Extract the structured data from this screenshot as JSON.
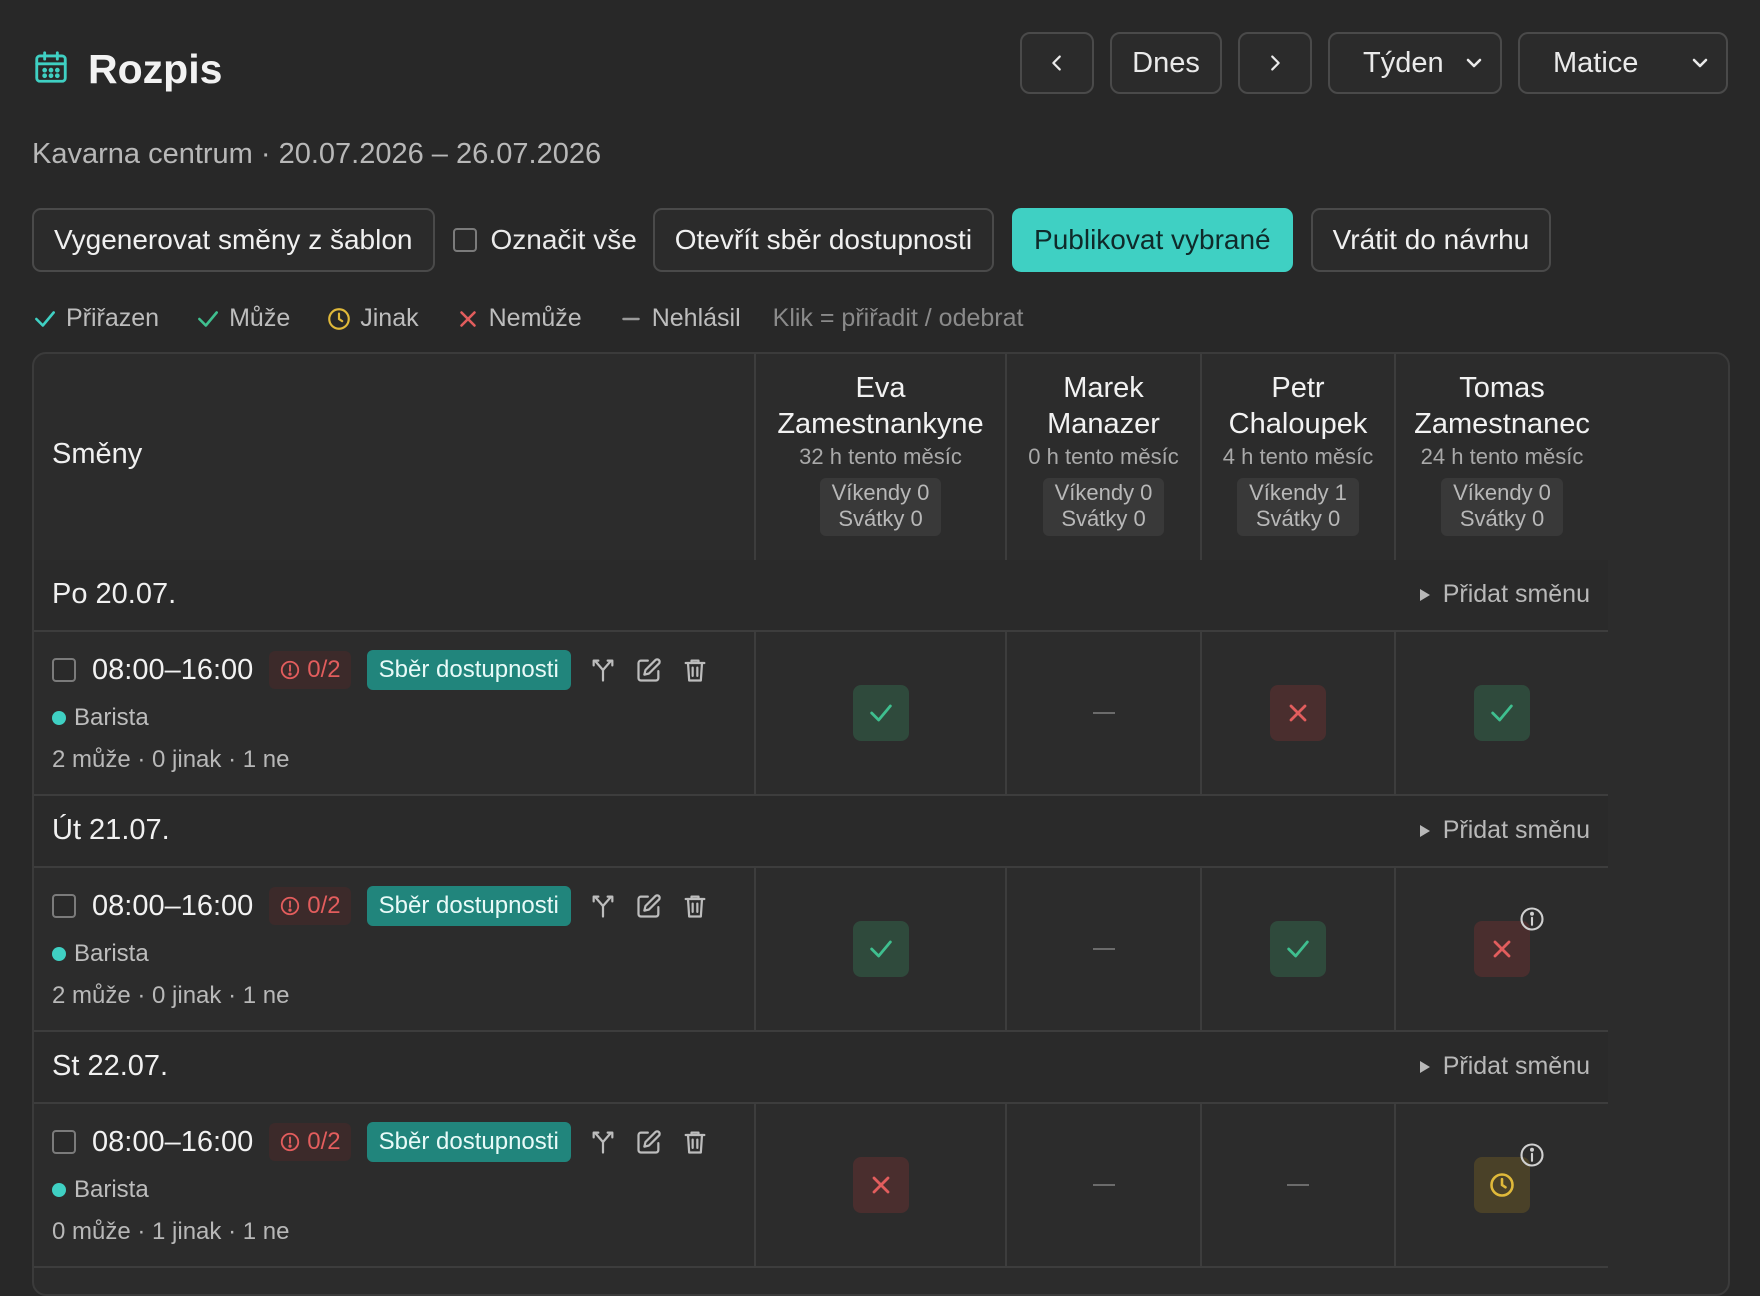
{
  "app": {
    "title": "Rozpis",
    "icon": "calendar-icon"
  },
  "nav": {
    "prev": "‹",
    "today": "Dnes",
    "next": "›",
    "period": "Týden",
    "view": "Matice"
  },
  "subtitle": "Kavarna centrum · 20.07.2026 – 26.07.2026",
  "toolbar": {
    "generate": "Vygenerovat směny z šablon",
    "select_all": "Označit vše",
    "open_collection": "Otevřít sběr dostupnosti",
    "publish": "Publikovat vybrané",
    "revert": "Vrátit do návrhu"
  },
  "legend": {
    "assigned": "Přiřazen",
    "can": "Může",
    "other": "Jinak",
    "cannot": "Nemůže",
    "none": "Nehlásil",
    "hint": "Klik = přiřadit / odebrat"
  },
  "colors": {
    "accent": "#3fd0c3",
    "ok": "#3fbf8f",
    "no": "#e25d5d",
    "maybe": "#e0b93a"
  },
  "table": {
    "shifts_header": "Směny",
    "employees": [
      {
        "name_line1": "Eva",
        "name_line2": "Zamestnankyne",
        "hours": "32 h tento měsíc",
        "weekends": "Víkendy 0",
        "holidays": "Svátky 0"
      },
      {
        "name_line1": "Marek",
        "name_line2": "Manazer",
        "hours": "0 h tento měsíc",
        "weekends": "Víkendy 0",
        "holidays": "Svátky 0"
      },
      {
        "name_line1": "Petr",
        "name_line2": "Chaloupek",
        "hours": "4 h tento měsíc",
        "weekends": "Víkendy 1",
        "holidays": "Svátky 0"
      },
      {
        "name_line1": "Tomas",
        "name_line2": "Zamestnanec",
        "hours": "24 h tento měsíc",
        "weekends": "Víkendy 0",
        "holidays": "Svátky 0"
      }
    ],
    "add_shift": "Přidat směnu",
    "days": [
      {
        "label": "Po 20.07.",
        "shift": {
          "time": "08:00–16:00",
          "staffing": "0/2",
          "status": "Sběr dostupnosti",
          "role": "Barista",
          "counts": "2 může · 0 jinak · 1 ne"
        },
        "cells": [
          "ok",
          "none",
          "no",
          "ok"
        ]
      },
      {
        "label": "Út 21.07.",
        "shift": {
          "time": "08:00–16:00",
          "staffing": "0/2",
          "status": "Sběr dostupnosti",
          "role": "Barista",
          "counts": "2 může · 0 jinak · 1 ne"
        },
        "cells": [
          "ok",
          "none",
          "ok",
          "no-info"
        ]
      },
      {
        "label": "St 22.07.",
        "shift": {
          "time": "08:00–16:00",
          "staffing": "0/2",
          "status": "Sběr dostupnosti",
          "role": "Barista",
          "counts": "0 může · 1 jinak · 1 ne"
        },
        "cells": [
          "no",
          "none",
          "none",
          "maybe-info"
        ]
      }
    ]
  }
}
